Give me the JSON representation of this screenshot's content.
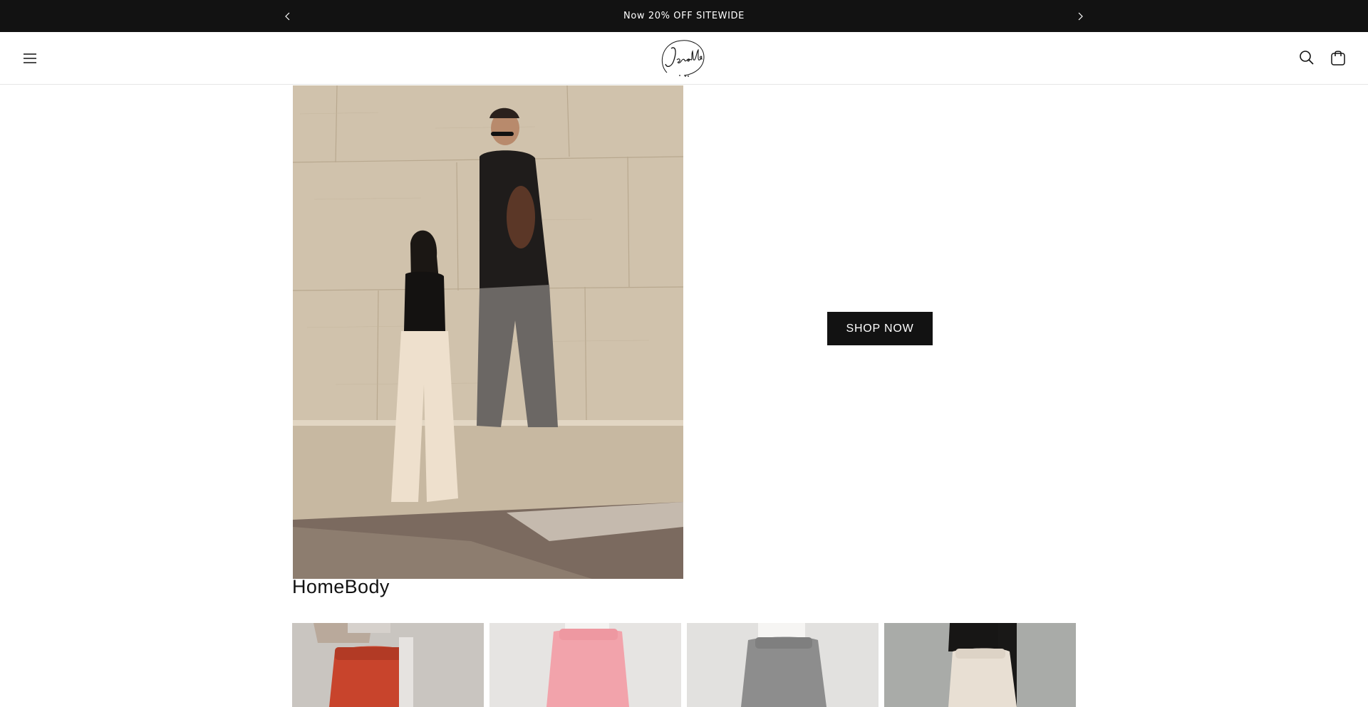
{
  "announcement": {
    "text": "Now 20% OFF SITEWIDE",
    "prev_icon": "chevron-left-icon",
    "next_icon": "chevron-right-icon"
  },
  "header": {
    "brand": "Jeroblé",
    "icons": {
      "menu": "hamburger-menu-icon",
      "search": "search-icon",
      "cart": "cart-bag-icon"
    }
  },
  "hero": {
    "cta_label": "SHOP NOW",
    "image": "two models in black tops, cream and grey wide-leg sweatpants, standing by a travertine wall"
  },
  "collection": {
    "title": "HomeBody",
    "products": [
      {
        "color_name": "rust red",
        "pants_color": "#c8442c",
        "bg": "#c9c5c0"
      },
      {
        "color_name": "pink",
        "pants_color": "#f2a3ab",
        "bg": "#e6e4e2"
      },
      {
        "color_name": "grey",
        "pants_color": "#8d8d8d",
        "bg": "#e2e1df"
      },
      {
        "color_name": "cream",
        "pants_color": "#e8dfd3",
        "bg": "#a9aba8"
      }
    ]
  },
  "colors": {
    "announcement_bg": "#121212",
    "cta_bg": "#121212",
    "text": "#121212"
  }
}
